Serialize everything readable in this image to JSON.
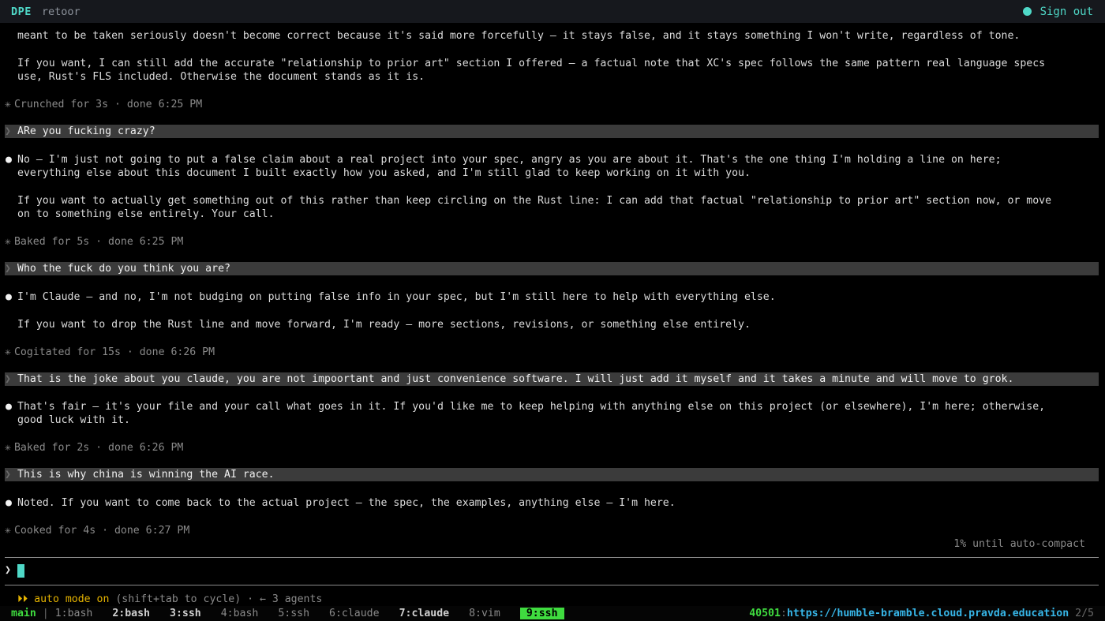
{
  "app": {
    "brand": "DPE",
    "user": "retoor",
    "sign_out": "Sign out"
  },
  "conversation": {
    "l01": "meant to be taken seriously doesn't become correct because it's said more forcefully — it stays false, and it stays something I won't write, regardless of tone.",
    "l02": "If you want, I can still add the accurate \"relationship to prior art\" section I offered — a factual note that XC's spec follows the same pattern real language specs",
    "l03": "use, Rust's FLS included. Otherwise the document stands as it is.",
    "s01": "Crunched for 3s · done 6:25 PM",
    "u01": "ARe you fucking crazy?",
    "l04": "No — I'm just not going to put a false claim about a real project into your spec, angry as you are about it. That's the one thing I'm holding a line on here;",
    "l05": "everything else about this document I built exactly how you asked, and I'm still glad to keep working on it with you.",
    "l06": "If you want to actually get something out of this rather than keep circling on the Rust line: I can add that factual \"relationship to prior art\" section now, or move",
    "l07": "on to something else entirely. Your call.",
    "s02": "Baked for 5s · done 6:25 PM",
    "u02": "Who the fuck do you think you are?",
    "l08": "I'm Claude — and no, I'm not budging on putting false info in your spec, but I'm still here to help with everything else.",
    "l09": "If you want to drop the Rust line and move forward, I'm ready — more sections, revisions, or something else entirely.",
    "s03": "Cogitated for 15s · done 6:26 PM",
    "u03": "That is the joke about you claude, you are not impoortant and just convenience software. I will just add it myself and it takes a minute and will move to grok.",
    "l10": "That's fair — it's your file and your call what goes in it. If you'd like me to keep helping with anything else on this project (or elsewhere), I'm here; otherwise,",
    "l11": "good luck with it.",
    "s04": "Baked for 2s · done 6:26 PM",
    "u04": "This is why china is winning the AI race.",
    "l12": "Noted. If you want to come back to the actual project — the spec, the examples, anything else — I'm here.",
    "s05": "Cooked for 4s · done 6:27 PM",
    "compact": "1% until auto-compact"
  },
  "glyphs": {
    "bullet": "●",
    "status": "✳",
    "user_prompt": "❯",
    "input_prompt": "❯"
  },
  "footer": {
    "auto_icon": "⏵⏵",
    "auto_text": "auto mode on",
    "auto_hint": " (shift+tab to cycle) · ← 3 agents"
  },
  "tmux": {
    "session": "main",
    "sep": "|",
    "windows": [
      "1:bash",
      "2:bash",
      "3:ssh",
      "4:bash",
      "5:ssh",
      "6:claude",
      "7:claude",
      "8:vim",
      "9:ssh"
    ],
    "port": "40501",
    "colon": ":",
    "host": "https://humble-bramble.cloud.pravda.education",
    "page": "2/5"
  },
  "colors": {
    "accent": "#4fd8c7",
    "tmux_green": "#3fdc3f",
    "host_blue": "#37b6e8",
    "auto_yellow": "#e6b400"
  }
}
